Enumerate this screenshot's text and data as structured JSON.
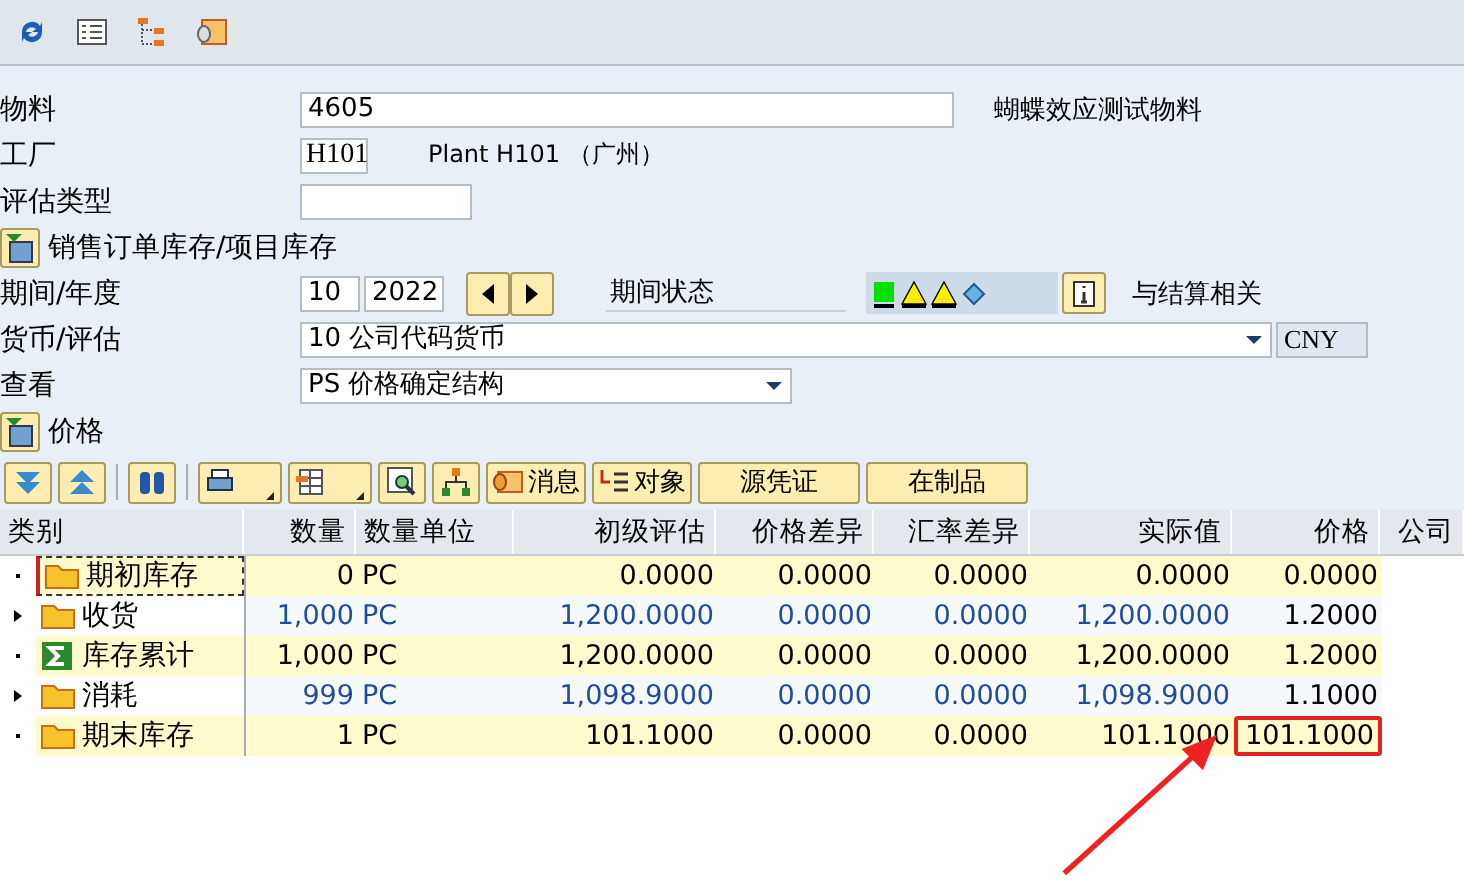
{
  "form": {
    "material": {
      "label": "物料",
      "value": "4605",
      "description": "蝴蝶效应测试物料"
    },
    "plant": {
      "label": "工厂",
      "value": "H101",
      "description": "Plant H101 （广州）"
    },
    "valuation_type": {
      "label": "评估类型"
    },
    "sales_order_stock": {
      "label": "销售订单库存/项目库存"
    },
    "period": {
      "label": "期间/年度",
      "period": "10",
      "year": "2022",
      "status_label": "期间状态",
      "lights": [
        {
          "kind": "green"
        },
        {
          "kind": "warning"
        },
        {
          "kind": "warning"
        },
        {
          "kind": "diamond"
        }
      ],
      "settlement_label": "与结算相关"
    },
    "currency": {
      "label": "货币/评估",
      "value": "10 公司代码货币",
      "code": "CNY"
    },
    "view": {
      "label": "查看",
      "value": "PS 价格确定结构"
    },
    "price_section": {
      "label": "价格"
    }
  },
  "table_toolbar": [
    {
      "label": "消息",
      "kind": "message"
    },
    {
      "label": "对象",
      "kind": "object"
    },
    {
      "label": "源凭证",
      "kind": "text"
    },
    {
      "label": "在制品",
      "kind": "text"
    }
  ],
  "table": {
    "columns": [
      "类别",
      "数量",
      "数量单位",
      "初级评估",
      "价格差异",
      "汇率差异",
      "实际值",
      "价格",
      "公司"
    ],
    "rows": [
      {
        "kind": "folder",
        "expandable": false,
        "highlighted": true,
        "focused": true,
        "circled": false,
        "cells": [
          "期初库存",
          "0",
          "PC",
          "0.0000",
          "0.0000",
          "0.0000",
          "0.0000",
          "0.0000"
        ]
      },
      {
        "kind": "folder",
        "expandable": true,
        "highlighted": false,
        "focused": false,
        "circled": false,
        "cells": [
          "收货",
          "1,000",
          "PC",
          "1,200.0000",
          "0.0000",
          "0.0000",
          "1,200.0000",
          "1.2000"
        ]
      },
      {
        "kind": "sum",
        "expandable": false,
        "highlighted": true,
        "focused": false,
        "circled": false,
        "cells": [
          "库存累计",
          "1,000",
          "PC",
          "1,200.0000",
          "0.0000",
          "0.0000",
          "1,200.0000",
          "1.2000"
        ]
      },
      {
        "kind": "folder",
        "expandable": true,
        "highlighted": false,
        "focused": false,
        "circled": false,
        "cells": [
          "消耗",
          "999",
          "PC",
          "1,098.9000",
          "0.0000",
          "0.0000",
          "1,098.9000",
          "1.1000"
        ]
      },
      {
        "kind": "folder",
        "expandable": false,
        "highlighted": true,
        "focused": false,
        "circled": true,
        "cells": [
          "期末库存",
          "1",
          "PC",
          "101.1000",
          "0.0000",
          "0.0000",
          "101.1000",
          "101.1000"
        ]
      }
    ]
  }
}
